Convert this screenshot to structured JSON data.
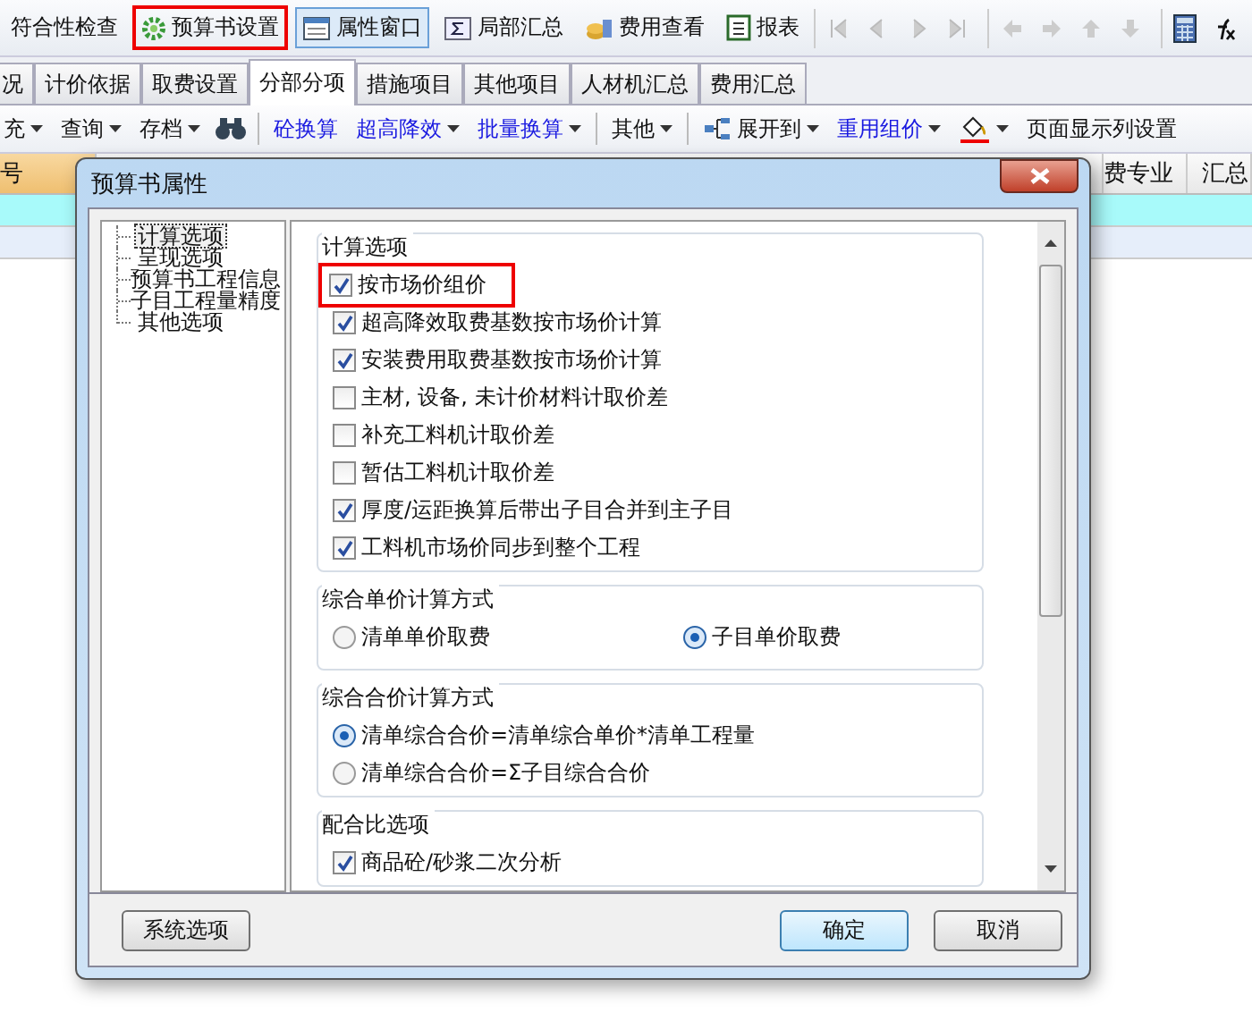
{
  "toolbar": [
    {
      "kind": "text",
      "label": "符合性检查",
      "highlighted": false,
      "pressed": false
    },
    {
      "kind": "gear",
      "label": "预算书设置",
      "highlighted": true,
      "pressed": false
    },
    {
      "kind": "window",
      "label": "属性窗口",
      "highlighted": false,
      "pressed": true
    },
    {
      "kind": "sum",
      "label": "局部汇总",
      "highlighted": false,
      "pressed": false
    },
    {
      "kind": "coins",
      "label": "费用查看",
      "highlighted": false,
      "pressed": false
    },
    {
      "kind": "report",
      "label": "报表",
      "highlighted": false,
      "pressed": false
    }
  ],
  "tabs": [
    {
      "label": "况",
      "selected": false
    },
    {
      "label": "计价依据",
      "selected": false
    },
    {
      "label": "取费设置",
      "selected": false
    },
    {
      "label": "分部分项",
      "selected": true
    },
    {
      "label": "措施项目",
      "selected": false
    },
    {
      "label": "其他项目",
      "selected": false
    },
    {
      "label": "人材机汇总",
      "selected": false
    },
    {
      "label": "费用汇总",
      "selected": false
    }
  ],
  "toolbar2": [
    {
      "kind": "menu",
      "label": "充",
      "link": false
    },
    {
      "kind": "menu",
      "label": "查询",
      "link": false
    },
    {
      "kind": "menu",
      "label": "存档",
      "link": false
    },
    {
      "kind": "binoculars"
    },
    {
      "kind": "sep"
    },
    {
      "kind": "text",
      "label": "砼换算",
      "link": true
    },
    {
      "kind": "menu",
      "label": "超高降效",
      "link": true
    },
    {
      "kind": "menu",
      "label": "批量换算",
      "link": true
    },
    {
      "kind": "sep"
    },
    {
      "kind": "menu",
      "label": "其他",
      "link": false
    },
    {
      "kind": "sep"
    },
    {
      "kind": "expand",
      "label": "展开到",
      "link": false
    },
    {
      "kind": "menu",
      "label": "重用组价",
      "link": true
    },
    {
      "kind": "bucket"
    },
    {
      "kind": "text",
      "label": "页面显示列设置",
      "link": false
    }
  ],
  "grid": {
    "columns": [
      "号",
      "费专业",
      "汇总"
    ]
  },
  "dialog": {
    "title": "预算书属性",
    "tree": [
      {
        "label": "计算选项",
        "selected": true
      },
      {
        "label": "呈现选项",
        "selected": false
      },
      {
        "label": "预算书工程信息",
        "selected": false
      },
      {
        "label": "子目工程量精度",
        "selected": false
      },
      {
        "label": "其他选项",
        "selected": false
      }
    ],
    "groups": [
      {
        "title": "计算选项",
        "kind": "checks",
        "options": [
          {
            "label": "按市场价组价",
            "checked": true,
            "highlighted": true
          },
          {
            "label": "超高降效取费基数按市场价计算",
            "checked": true,
            "highlighted": false
          },
          {
            "label": "安装费用取费基数按市场价计算",
            "checked": true,
            "highlighted": false
          },
          {
            "label": "主材, 设备, 未计价材料计取价差",
            "checked": false,
            "highlighted": false
          },
          {
            "label": "补充工料机计取价差",
            "checked": false,
            "highlighted": false
          },
          {
            "label": "暂估工料机计取价差",
            "checked": false,
            "highlighted": false
          },
          {
            "label": "厚度/运距换算后带出子目合并到主子目",
            "checked": true,
            "highlighted": false
          },
          {
            "label": "工料机市场价同步到整个工程",
            "checked": true,
            "highlighted": false
          }
        ]
      },
      {
        "title": "综合单价计算方式",
        "kind": "radios-row",
        "options": [
          {
            "label": "清单单价取费",
            "selected": false
          },
          {
            "label": "子目单价取费",
            "selected": true
          }
        ]
      },
      {
        "title": "综合合价计算方式",
        "kind": "radios",
        "options": [
          {
            "label": "清单综合合价=清单综合单价*清单工程量",
            "selected": true
          },
          {
            "label": "清单综合合价=Σ子目综合合价",
            "selected": false
          }
        ]
      },
      {
        "title": "配合比选项",
        "kind": "checks",
        "options": [
          {
            "label": "商品砼/砂浆二次分析",
            "checked": true,
            "highlighted": false
          }
        ]
      }
    ],
    "buttons": [
      {
        "label": "系统选项",
        "default": false
      },
      {
        "label": "确定",
        "default": true
      },
      {
        "label": "取消",
        "default": false
      }
    ]
  }
}
